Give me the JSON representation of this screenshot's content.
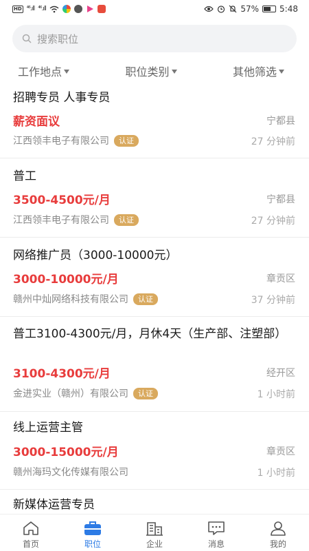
{
  "status_bar": {
    "hd": "HD",
    "sig1": "⁴⁶.ıll",
    "sig2": "⁴⁶.ıll",
    "battery_pct": "57%",
    "time": "5:48"
  },
  "search": {
    "placeholder": "搜索职位"
  },
  "filters": [
    {
      "label": "工作地点"
    },
    {
      "label": "职位类别"
    },
    {
      "label": "其他筛选"
    }
  ],
  "jobs": [
    {
      "title": "招聘专员 人事专员",
      "salary": "薪资面议",
      "location": "宁都县",
      "company": "江西领丰电子有限公司",
      "badge": "认证",
      "time": "27 分钟前"
    },
    {
      "title": "普工",
      "salary": "3500-4500元/月",
      "location": "宁都县",
      "company": "江西领丰电子有限公司",
      "badge": "认证",
      "time": "27 分钟前"
    },
    {
      "title": "网络推广员（3000-10000元）",
      "salary": "3000-10000元/月",
      "location": "章贡区",
      "company": "赣州中灿网络科技有限公司",
      "badge": "认证",
      "time": "37 分钟前"
    },
    {
      "title": "普工3100-4300元/月，月休4天（生产部、注塑部）",
      "salary": "3100-4300元/月",
      "location": "经开区",
      "company": "金进实业（赣州）有限公司",
      "badge": "认证",
      "time": "1 小时前"
    },
    {
      "title": "线上运营主管",
      "salary": "3000-15000元/月",
      "location": "章贡区",
      "company": "赣州海玛文化传媒有限公司",
      "badge": "",
      "time": "1 小时前"
    },
    {
      "title": "新媒体运营专员"
    }
  ],
  "bottom_nav": [
    {
      "label": "首页",
      "icon": "home-icon"
    },
    {
      "label": "职位",
      "icon": "briefcase-icon",
      "active": true
    },
    {
      "label": "企业",
      "icon": "building-icon"
    },
    {
      "label": "消息",
      "icon": "message-icon"
    },
    {
      "label": "我的",
      "icon": "person-icon"
    }
  ],
  "colors": {
    "accent": "#2d7be5",
    "salary": "#e83c3c",
    "badge": "#d9a95e"
  }
}
